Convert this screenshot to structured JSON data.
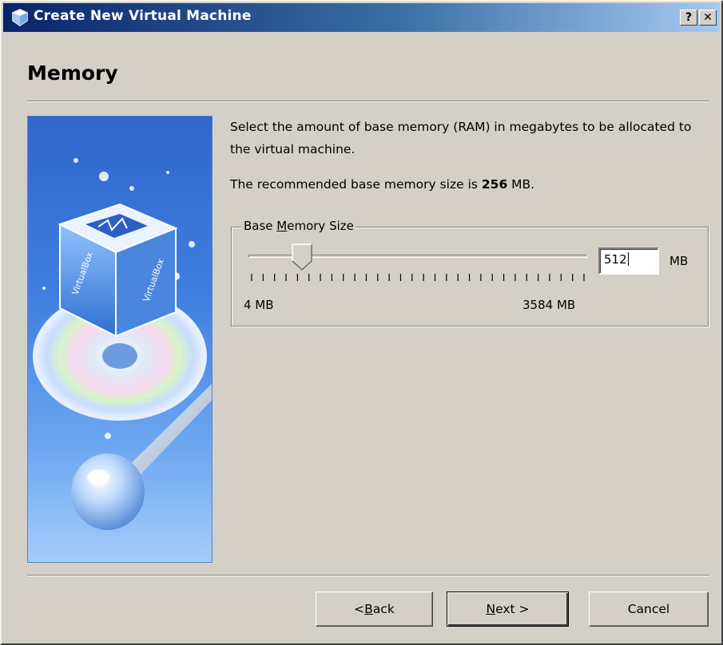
{
  "window": {
    "title": "Create New Virtual Machine",
    "help_button": "?",
    "close_button": "✕"
  },
  "page": {
    "title": "Memory",
    "description": "Select the amount of base memory (RAM) in megabytes to be allocated to the virtual machine.",
    "recommend_prefix": "The recommended base memory size is ",
    "recommend_value": "256",
    "recommend_suffix": " MB."
  },
  "memory_group": {
    "label_pre": "Base ",
    "label_mnemonic": "M",
    "label_post": "emory Size",
    "slider_min_label": "4 MB",
    "slider_max_label": "3584 MB",
    "slider_min": 4,
    "slider_max": 3584,
    "slider_value": 512,
    "input_value": "512",
    "unit": "MB"
  },
  "buttons": {
    "back_pre": "< ",
    "back_mnemonic": "B",
    "back_post": "ack",
    "next_mnemonic": "N",
    "next_post": "ext >",
    "cancel": "Cancel"
  },
  "colors": {
    "titlebar_start": "#0a246a",
    "titlebar_end": "#a6caf0",
    "dialog_bg": "#d4d0c8"
  },
  "icons": {
    "title_icon": "virtualbox-icon",
    "side_image": "virtualbox-wizard-art"
  }
}
